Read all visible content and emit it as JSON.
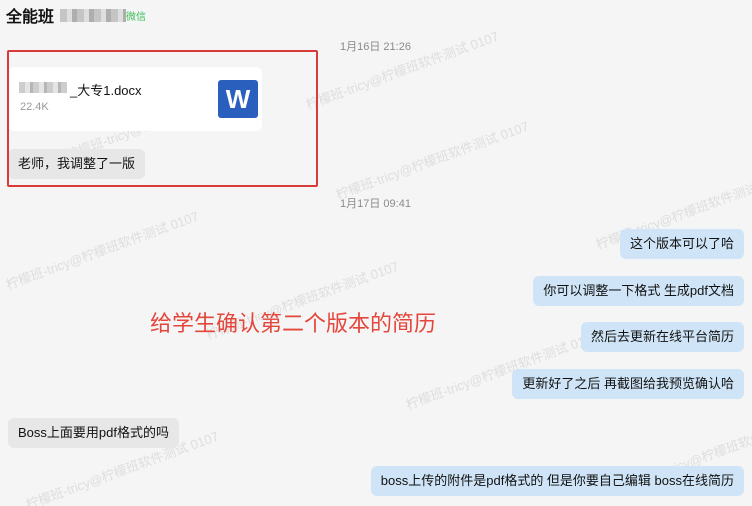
{
  "header": {
    "title": "全能班",
    "tag": "微信"
  },
  "timestamps": [
    "1月16日 21:26",
    "1月17日 09:41"
  ],
  "file_card": {
    "name_suffix": "_大专1.docx",
    "size": "22.4K",
    "icon": "word-icon",
    "icon_letter": "W"
  },
  "messages": {
    "m1": "老师，我调整了一版",
    "m2": "这个版本可以了哈",
    "m3": "你可以调整一下格式 生成pdf文档",
    "m4": "然后去更新在线平台简历",
    "m5": "更新好了之后 再截图给我预览确认哈",
    "m6": "Boss上面要用pdf格式的吗",
    "m7": "boss上传的附件是pdf格式的  但是你要自己编辑 boss在线简历"
  },
  "annotation": "给学生确认第二个版本的简历",
  "watermark": "柠檬班-tricy@柠檬班软件测试 0107",
  "colors": {
    "annotation_red": "#e4463c",
    "self_bubble": "#cfe5f7",
    "other_bubble": "#e7e7e7",
    "word_blue": "#2b5fbd"
  }
}
